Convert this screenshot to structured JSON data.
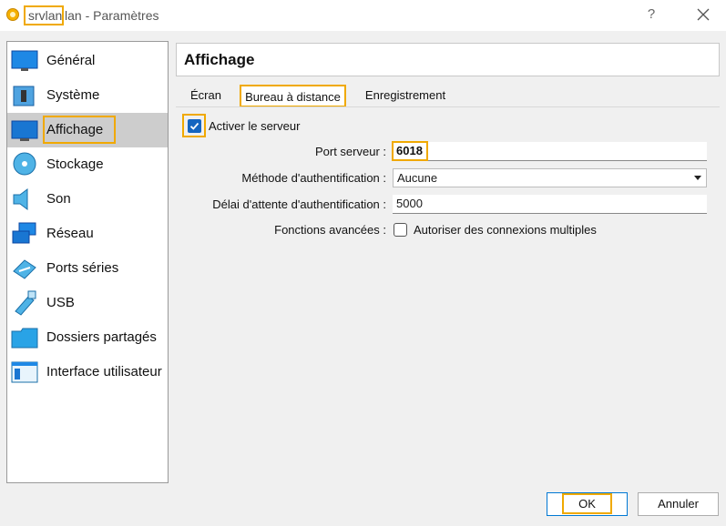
{
  "window": {
    "title_highlight": "srvlan",
    "title_rest": "lan - Paramètres",
    "help_label": "?",
    "accent_highlight": "#f0a900"
  },
  "sidebar": {
    "items": [
      {
        "label": "Général",
        "icon": "monitor-icon"
      },
      {
        "label": "Système",
        "icon": "chip-icon"
      },
      {
        "label": "Affichage",
        "icon": "display-icon",
        "selected": true
      },
      {
        "label": "Stockage",
        "icon": "disk-icon"
      },
      {
        "label": "Son",
        "icon": "speaker-icon"
      },
      {
        "label": "Réseau",
        "icon": "network-icon"
      },
      {
        "label": "Ports séries",
        "icon": "serial-port-icon"
      },
      {
        "label": "USB",
        "icon": "usb-icon"
      },
      {
        "label": "Dossiers partagés",
        "icon": "folder-icon"
      },
      {
        "label": "Interface utilisateur",
        "icon": "window-icon"
      }
    ]
  },
  "section": {
    "title": "Affichage"
  },
  "tabs": [
    {
      "label": "Écran"
    },
    {
      "label": "Bureau à distance",
      "active": true
    },
    {
      "label": "Enregistrement"
    }
  ],
  "form": {
    "enable_server_label": "Activer le serveur",
    "enable_server_checked": true,
    "port_label": "Port serveur :",
    "port_value": "6018",
    "auth_method_label": "Méthode d'authentification :",
    "auth_method_value": "Aucune",
    "auth_timeout_label": "Délai d'attente d'authentification :",
    "auth_timeout_value": "5000",
    "advanced_label": "Fonctions avancées :",
    "multi_conn_label": "Autoriser des connexions multiples",
    "multi_conn_checked": false
  },
  "buttons": {
    "ok": "OK",
    "cancel": "Annuler"
  }
}
